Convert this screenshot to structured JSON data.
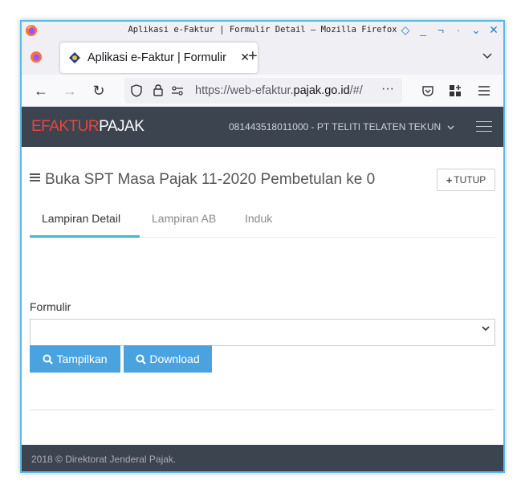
{
  "window": {
    "title": "Aplikasi e-Faktur | Formulir Detail — Mozilla Firefox"
  },
  "browser": {
    "tab_title": "Aplikasi e-Faktur | Formulir Detail",
    "url_prefix": "https://web-efaktur.",
    "url_domain": "pajak.go.id",
    "url_suffix": "/#/"
  },
  "app": {
    "brand_part1": "EFAKTUR",
    "brand_part2": "PAJAK",
    "user_menu": "081443518011000 - PT TELITI TELATEN TEKUN",
    "colors": {
      "header": "#3c4450",
      "accent_red": "#e8463c",
      "button": "#4aa3df",
      "tab_underline": "#3db8d6"
    }
  },
  "page": {
    "title": "Buka SPT Masa Pajak 11-2020 Pembetulan ke 0",
    "close_label": "TUTUP",
    "tabs": [
      {
        "label": "Lampiran Detail",
        "active": true
      },
      {
        "label": "Lampiran AB",
        "active": false
      },
      {
        "label": "Induk",
        "active": false
      }
    ],
    "form_label": "Formulir",
    "select_value": "",
    "show_button": "Tampilkan",
    "download_button": "Download"
  },
  "footer": {
    "text": "2018 © Direktorat Jenderal Pajak."
  }
}
